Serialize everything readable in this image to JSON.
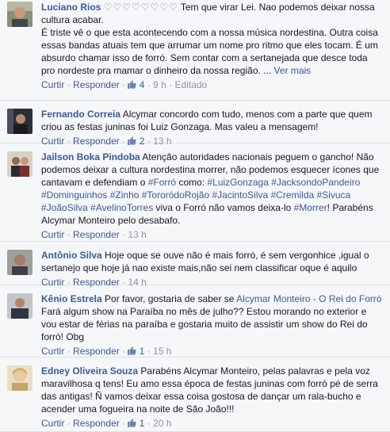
{
  "comments": [
    {
      "author": "Luciano Rios",
      "hearts": "♡♡♡♡♡♡♡♡",
      "p1": "Tem que virar Lei. Nao podemos deixar nossa cultura acabar.",
      "p2": "É triste vê o que esta acontecendo com a nossa música nordestina. Outra coisa essas bandas atuais tem que arrumar um nome pro ritmo que eles tocam. É um absurdo chamar isso de forró. Sem contar com a sertanejada que desce toda pro nordeste pra mamar o dinheiro da nossa região. ...",
      "see_more": "Ver mais",
      "reply_label": "Curtir",
      "respond_label": "Responder",
      "likes": "4",
      "time": "9 h",
      "edited": "Editado"
    },
    {
      "author": "Fernando Correia",
      "text": "Alcymar concordo com tudo, menos com a parte que quem criou as festas juninas foi Luiz Gonzaga. Mas valeu a mensagem!",
      "reply_label": "Curtir",
      "respond_label": "Responder",
      "likes": "2",
      "time": "13 h"
    },
    {
      "author": "Jailson Boka Pindoba",
      "text": "Atenção autoridades nacionais peguem o gancho! Não podemos deixar a cultura nordestina morrer, não podemos esquecer ícones que cantavam e defendiam o",
      "hashtag_forro": "#Forró",
      "text2": "como:",
      "hashtags": "#LuizGonzaga #JacksondoPandeiro #Dominguinhos #Zinho #TororódoRojão #JacintoSilva #Cremilda #Sivuca #JoãoSilva #AvelinoTorres",
      "text3": "viva o Forró não vamos deixa-lo",
      "hashtag_morrer": "#Morrer",
      "text4": "! Parabéns Alcymar Monteiro pelo desabafo.",
      "reply_label": "Curtir",
      "respond_label": "Responder",
      "time": "13 h"
    },
    {
      "author": "Antônio Silva",
      "text": "Hoje oque se ouve não é mais forró, é sem vergonhice ,igual o sertanejo que hoje já nao existe mais,não sei nem classificar oque é aquilo",
      "reply_label": "Curtir",
      "respond_label": "Responder",
      "time": "14 h"
    },
    {
      "author": "Kênio Estrela",
      "text": "Por favor, gostaria de saber se",
      "mention": "Alcymar Monteiro - O Rei do Forró",
      "text2": "Fará algum show na Paraíba no mês de julho?? Estou morando no exterior e vou estar de férias na paraíba e gostaria muito de assistir um show do Rei do forró! Obg",
      "reply_label": "Curtir",
      "respond_label": "Responder",
      "likes": "1",
      "time": "15 h"
    },
    {
      "author": "Edney Oliveira Souza",
      "text": "Parabéns Alcymar Monteiro, pelas palavras e pela voz maravilhosa q tens! Eu amo essa época de festas juninas com forró pé de serra das antigas! Ñ vamos deixar essa coisa gostosa de dançar um rala-bucho e acender uma fogueira na noite de São João!!!",
      "reply_label": "Curtir",
      "respond_label": "Responder",
      "likes": "1",
      "time": "20 h"
    }
  ],
  "colors": {
    "link": "#3b5998",
    "meta": "#90949c",
    "text": "#141823",
    "bg": "#f6f7f9"
  }
}
